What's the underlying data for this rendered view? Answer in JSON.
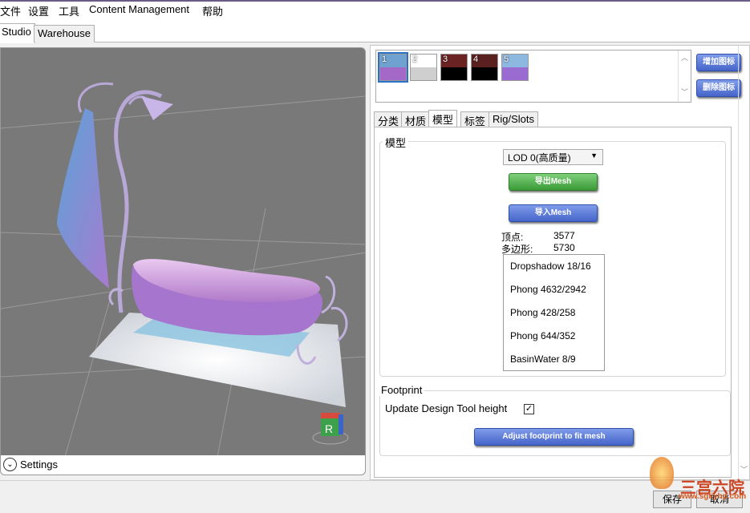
{
  "menu": [
    "文件",
    "设置",
    "工具",
    "Content Management",
    "帮助"
  ],
  "main_tabs": [
    "Studio",
    "Warehouse"
  ],
  "viewport": {
    "settings_label": "Settings",
    "cube_label": "R"
  },
  "swatches": [
    {
      "n": "1",
      "top": "#6fa2d0",
      "bottom": "#a468c6"
    },
    {
      "n": "2",
      "top": "#ffffff",
      "bottom": "#cfcfcf"
    },
    {
      "n": "3",
      "top": "#6a2222",
      "bottom": "#000000"
    },
    {
      "n": "4",
      "top": "#5a2020",
      "bottom": "#000000"
    },
    {
      "n": "5",
      "top": "#8db8e0",
      "bottom": "#9a6cd2"
    }
  ],
  "buttons": {
    "add_swatch": "增加图标",
    "remove_swatch": "删除图标",
    "export_mesh": "导出Mesh",
    "import_mesh": "导入Mesh",
    "adjust_footprint": "Adjust footprint to fit mesh",
    "save": "保存",
    "cancel": "取消"
  },
  "sub_tabs": [
    "分类",
    "材质",
    "模型",
    "标签",
    "Rig/Slots"
  ],
  "model": {
    "group_label": "模型",
    "lod": "LOD 0(高质量)",
    "vertices_label": "顶点:",
    "vertices": "3577",
    "polygons_label": "多边形:",
    "polygons": "5730",
    "meshes": [
      "Dropshadow 18/16",
      "Phong 4632/2942",
      "Phong 428/258",
      "Phong 644/352",
      "BasinWater 8/9"
    ]
  },
  "footprint": {
    "group_label": "Footprint",
    "update_label": "Update Design Tool height",
    "update_checked": "✓"
  },
  "watermark": {
    "text": "三宫六院",
    "url": "www.sgliyhp.com"
  }
}
